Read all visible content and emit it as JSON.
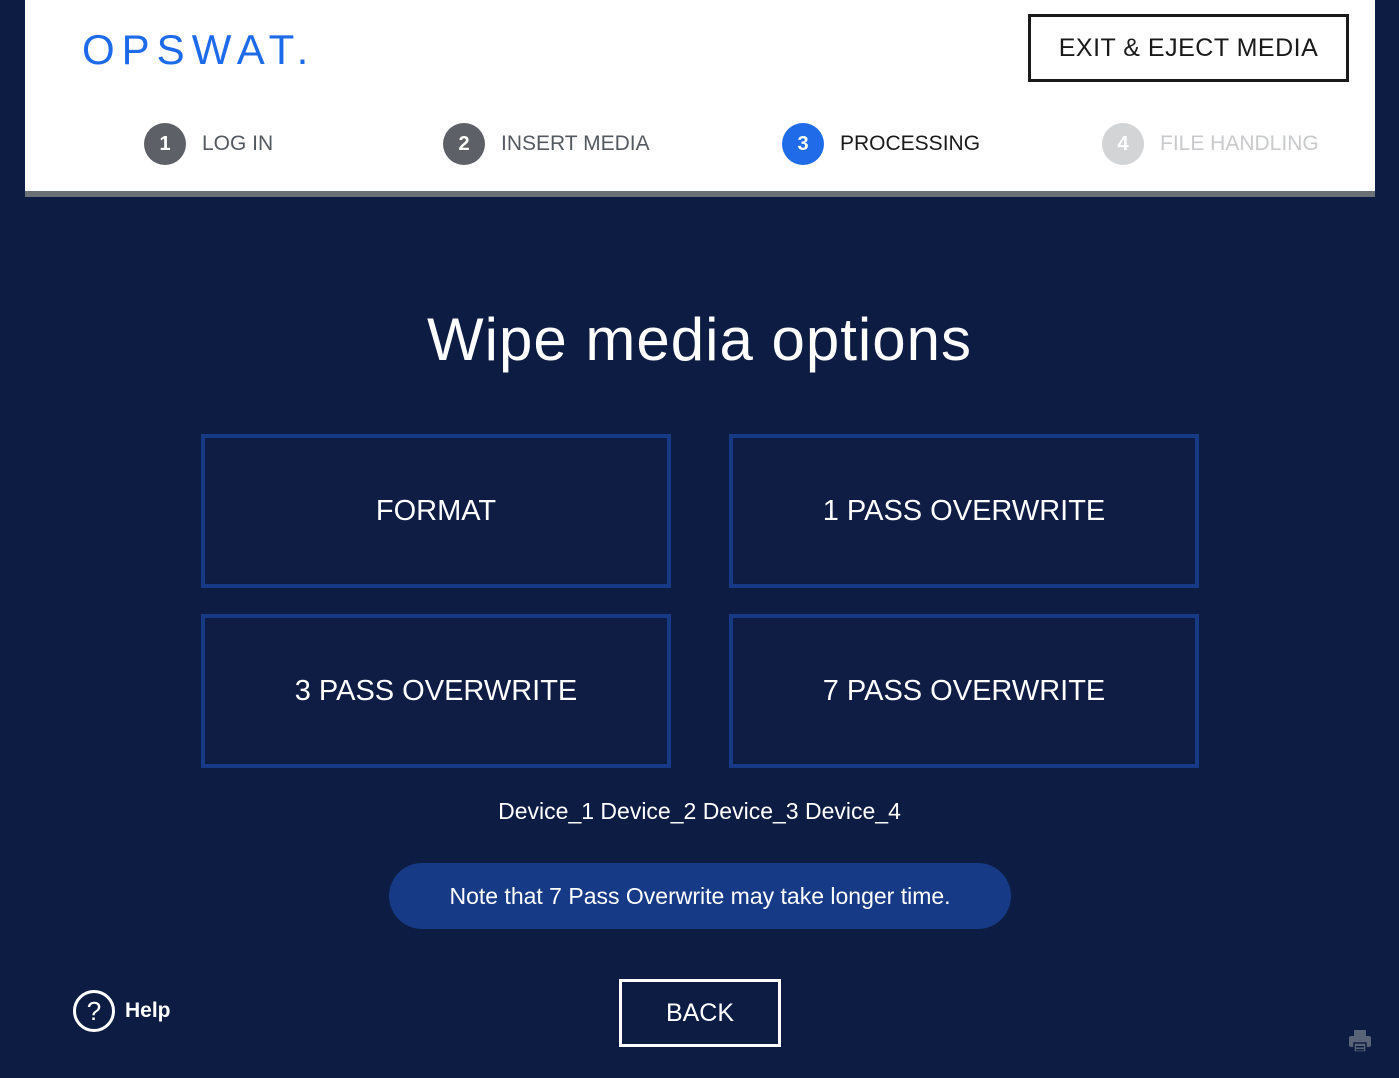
{
  "header": {
    "logo_text": "OPSWAT.",
    "exit_label": "EXIT & EJECT MEDIA",
    "steps": [
      {
        "number": "1",
        "label": "LOG IN",
        "state": "done"
      },
      {
        "number": "2",
        "label": "INSERT MEDIA",
        "state": "done"
      },
      {
        "number": "3",
        "label": "PROCESSING",
        "state": "active"
      },
      {
        "number": "4",
        "label": "FILE HANDLING",
        "state": "todo"
      }
    ]
  },
  "main": {
    "title": "Wipe media options",
    "options": [
      {
        "label": "FORMAT"
      },
      {
        "label": "1 PASS OVERWRITE"
      },
      {
        "label": "3 PASS OVERWRITE"
      },
      {
        "label": "7 PASS OVERWRITE"
      }
    ],
    "devices": "Device_1 Device_2 Device_3 Device_4",
    "note": "Note that 7 Pass Overwrite may take longer time."
  },
  "footer": {
    "help_label": "Help",
    "back_label": "BACK",
    "help_icon": "question-circle-icon",
    "printer_icon": "printer-icon"
  },
  "colors": {
    "background": "#0d1c43",
    "brand_blue": "#1d6bea",
    "option_border": "#163a86",
    "note_bg": "#163a86"
  }
}
